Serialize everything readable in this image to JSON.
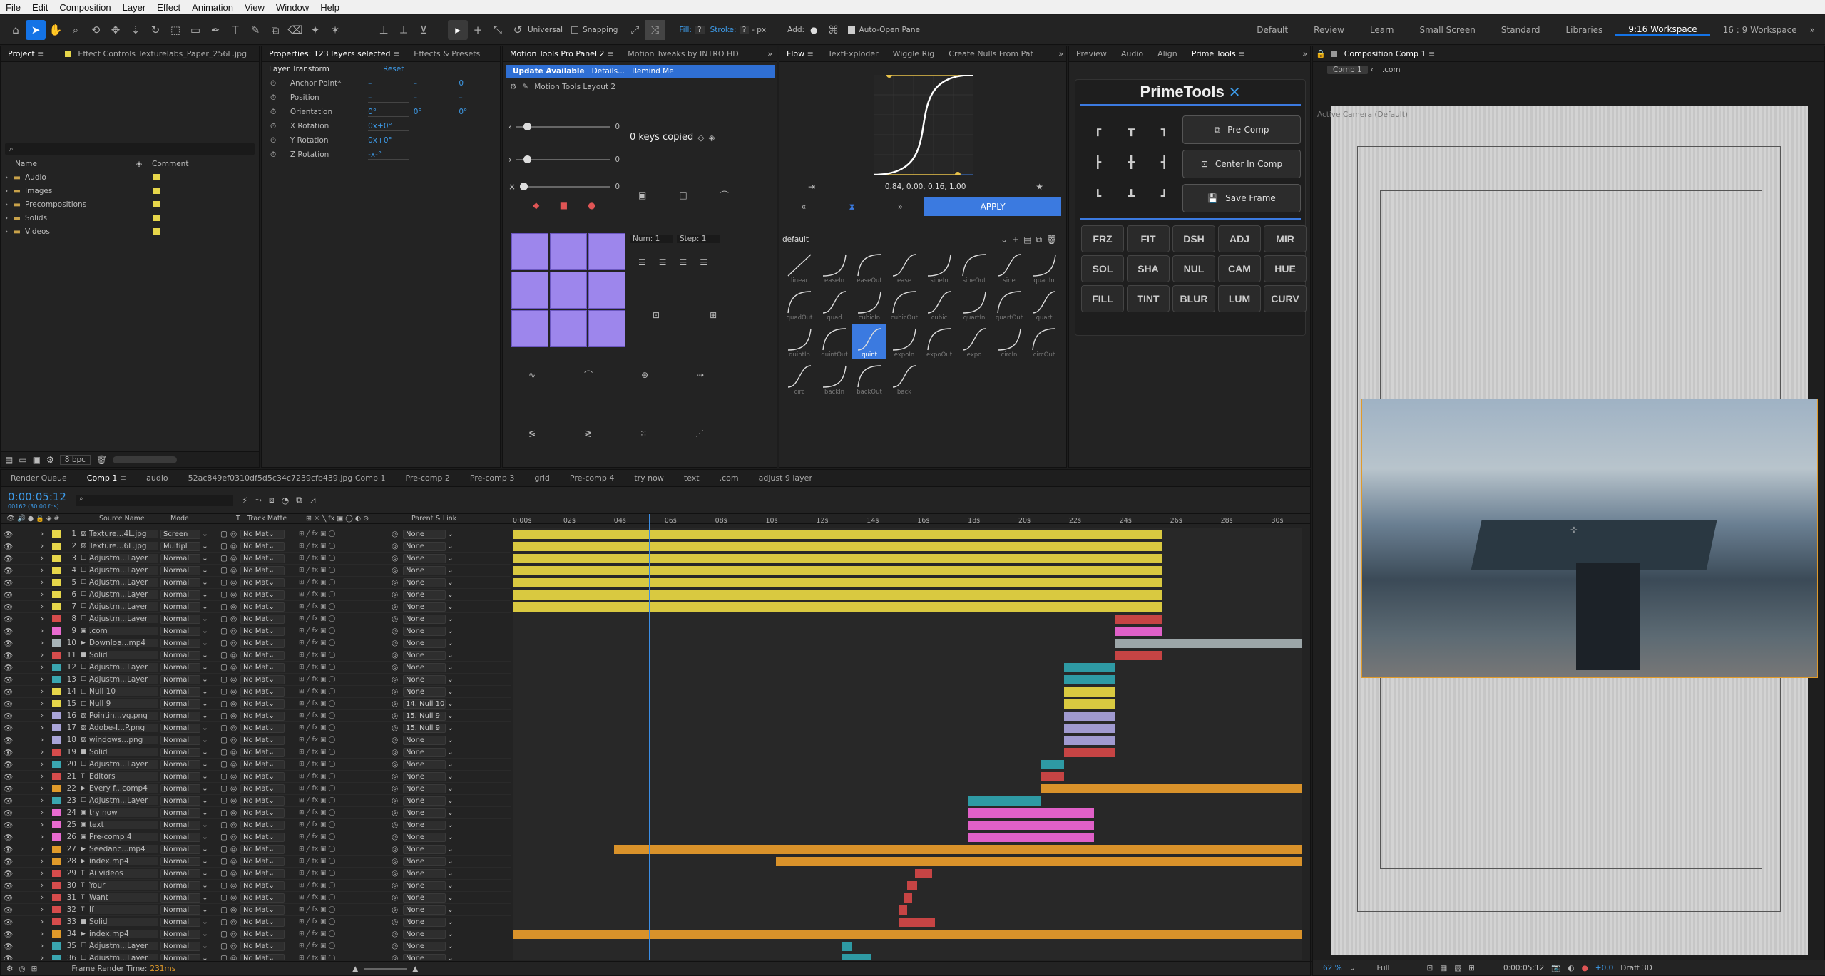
{
  "menu": [
    "File",
    "Edit",
    "Composition",
    "Layer",
    "Effect",
    "Animation",
    "View",
    "Window",
    "Help"
  ],
  "toolbar": {
    "axis_mode": "Universal",
    "snapping": "Snapping",
    "fill_label": "Fill:",
    "fill_value": "?",
    "stroke_label": "Stroke:",
    "stroke_value": "?",
    "stroke_px": "- px",
    "add_label": "Add:",
    "auto_open": "Auto-Open Panel",
    "workspaces": [
      "Default",
      "Review",
      "Learn",
      "Small Screen",
      "Standard",
      "Libraries",
      "9:16 Workspace",
      "16 : 9 Workspace"
    ],
    "active_workspace": "9:16 Workspace"
  },
  "project": {
    "tab": "Project",
    "effect_controls": "Effect Controls Texturelabs_Paper_256L.jpg",
    "search_placeholder": "",
    "col_name": "Name",
    "col_comment": "Comment",
    "folders": [
      "Audio",
      "Images",
      "Precompositions",
      "Solids",
      "Videos"
    ],
    "bpc": "8 bpc"
  },
  "properties": {
    "tab": "Properties: 123 layers selected",
    "tab2": "Effects & Presets",
    "section": "Layer Transform",
    "reset": "Reset",
    "rows": [
      {
        "label": "Anchor Point*",
        "v1": "–",
        "v2": "–",
        "v3": "0"
      },
      {
        "label": "Position",
        "v1": "–",
        "v2": "–",
        "v3": "–"
      },
      {
        "label": "Orientation",
        "v1": "0°",
        "v2": "0°",
        "v3": "0°"
      },
      {
        "label": "X Rotation",
        "v1": "0x+0°",
        "v2": "",
        "v3": ""
      },
      {
        "label": "Y Rotation",
        "v1": "0x+0°",
        "v2": "",
        "v3": ""
      },
      {
        "label": "Z Rotation",
        "v1": "-x-°",
        "v2": "",
        "v3": ""
      }
    ]
  },
  "motiontools": {
    "tab": "Motion Tools Pro Panel 2",
    "tab2": "Motion Tweaks by INTRO HD",
    "update": "Update Available",
    "details": "Details...",
    "remind": "Remind Me",
    "layout": "Motion Tools Layout 2",
    "keys_copied": "0 keys copied",
    "slider_values": [
      "0",
      "0",
      "0"
    ],
    "num": "Num: 1",
    "step": "Step: 1"
  },
  "flow": {
    "tabs": [
      "Flow",
      "TextExploder",
      "Wiggle Rig",
      "Create Nulls From Pat"
    ],
    "bezier": "0.84, 0.00, 0.16, 1.00",
    "apply": "APPLY",
    "preset": "default",
    "easings": [
      "linear",
      "easeIn",
      "easeOut",
      "ease",
      "sineIn",
      "sineOut",
      "sine",
      "quadIn",
      "quadOut",
      "quad",
      "cubicIn",
      "cubicOut",
      "cubic",
      "quartIn",
      "quartOut",
      "quart",
      "quintIn",
      "quintOut",
      "quint",
      "expoIn",
      "expoOut",
      "expo",
      "circIn",
      "circOut",
      "circ",
      "backIn",
      "backOut",
      "back"
    ],
    "selected_easing": "quint"
  },
  "primetools": {
    "tabs": [
      "Preview",
      "Audio",
      "Align",
      "Prime Tools"
    ],
    "title": "PrimeTools",
    "precomp": "Pre-Comp",
    "center": "Center In Comp",
    "save": "Save Frame",
    "buttons": [
      "FRZ",
      "FIT",
      "DSH",
      "ADJ",
      "MIR",
      "SOL",
      "SHA",
      "NUL",
      "CAM",
      "HUE",
      "FILL",
      "TINT",
      "BLUR",
      "LUM",
      "CURV"
    ]
  },
  "composition": {
    "tab": "Composition Comp 1",
    "crumb1": "Comp 1",
    "crumb2": ".com",
    "camera": "Active Camera (Default)",
    "zoom": "62 %",
    "quality": "Full",
    "time": "0:00:05:12",
    "exposure": "+0.0",
    "draft": "Draft 3D"
  },
  "timeline": {
    "tabs": [
      "Render Queue",
      "Comp 1",
      "audio",
      "52ac849ef0310df5d5c34c7239cfb439.jpg Comp 1",
      "Pre-comp 2",
      "Pre-comp 3",
      "grid",
      "Pre-comp 4",
      "try now",
      "text",
      ".com",
      "adjust 9 layer"
    ],
    "active_tab": "Comp 1",
    "timecode": "0:00:05:12",
    "frames": "00162 (30.00 fps)",
    "col_source": "Source Name",
    "col_mode": "Mode",
    "col_t": "T",
    "col_matte": "Track Matte",
    "col_parent": "Parent & Link",
    "ruler": [
      "0:00s",
      "02s",
      "04s",
      "06s",
      "08s",
      "10s",
      "12s",
      "14s",
      "16s",
      "18s",
      "20s",
      "22s",
      "24s",
      "26s",
      "28s",
      "30s"
    ],
    "render_time_label": "Frame Render Time:",
    "render_time": "231ms",
    "layers": [
      {
        "n": "1",
        "name": "Texture...4L.jpg",
        "mode": "Screen",
        "parent": "None",
        "color": "#e6d64a",
        "icon": "img"
      },
      {
        "n": "2",
        "name": "Texture...6L.jpg",
        "mode": "Multipl",
        "parent": "None",
        "color": "#e6d64a",
        "icon": "img"
      },
      {
        "n": "3",
        "name": "Adjustm...Layer",
        "mode": "Normal",
        "parent": "None",
        "color": "#e6d64a",
        "icon": "adj"
      },
      {
        "n": "4",
        "name": "Adjustm...Layer",
        "mode": "Normal",
        "parent": "None",
        "color": "#e6d64a",
        "icon": "adj"
      },
      {
        "n": "5",
        "name": "Adjustm...Layer",
        "mode": "Normal",
        "parent": "None",
        "color": "#e6d64a",
        "icon": "adj"
      },
      {
        "n": "6",
        "name": "Adjustm...Layer",
        "mode": "Normal",
        "parent": "None",
        "color": "#e6d64a",
        "icon": "adj"
      },
      {
        "n": "7",
        "name": "Adjustm...Layer",
        "mode": "Normal",
        "parent": "None",
        "color": "#e6d64a",
        "icon": "adj"
      },
      {
        "n": "8",
        "name": "Adjustm...Layer",
        "mode": "Normal",
        "parent": "None",
        "color": "#d64c4c",
        "icon": "adj"
      },
      {
        "n": "9",
        "name": ".com",
        "mode": "Normal",
        "parent": "None",
        "color": "#e86bd0",
        "icon": "comp"
      },
      {
        "n": "10",
        "name": "Downloa...mp4",
        "mode": "Normal",
        "parent": "None",
        "color": "#a8b4b8",
        "icon": "vid"
      },
      {
        "n": "11",
        "name": "Solid",
        "mode": "Normal",
        "parent": "None",
        "color": "#d64c4c",
        "icon": "sol"
      },
      {
        "n": "12",
        "name": "Adjustm...Layer",
        "mode": "Normal",
        "parent": "None",
        "color": "#3aa6b0",
        "icon": "adj"
      },
      {
        "n": "13",
        "name": "Adjustm...Layer",
        "mode": "Normal",
        "parent": "None",
        "color": "#3aa6b0",
        "icon": "adj"
      },
      {
        "n": "14",
        "name": "Null 10",
        "mode": "Normal",
        "parent": "None",
        "color": "#e6d64a",
        "icon": "null"
      },
      {
        "n": "15",
        "name": "Null 9",
        "mode": "Normal",
        "parent": "14. Null 10",
        "color": "#e6d64a",
        "icon": "null"
      },
      {
        "n": "16",
        "name": "Pointin...vg.png",
        "mode": "Normal",
        "parent": "15. Null 9",
        "color": "#a9a4d8",
        "icon": "img"
      },
      {
        "n": "17",
        "name": "Adobe-I...P.png",
        "mode": "Normal",
        "parent": "15. Null 9",
        "color": "#a9a4d8",
        "icon": "img"
      },
      {
        "n": "18",
        "name": "windows...png",
        "mode": "Normal",
        "parent": "None",
        "color": "#a9a4d8",
        "icon": "img"
      },
      {
        "n": "19",
        "name": "Solid",
        "mode": "Normal",
        "parent": "None",
        "color": "#d64c4c",
        "icon": "sol"
      },
      {
        "n": "20",
        "name": "Adjustm...Layer",
        "mode": "Normal",
        "parent": "None",
        "color": "#3aa6b0",
        "icon": "adj"
      },
      {
        "n": "21",
        "name": "Editors",
        "mode": "Normal",
        "parent": "None",
        "color": "#d64c4c",
        "icon": "txt"
      },
      {
        "n": "22",
        "name": "Every f...comp4",
        "mode": "Normal",
        "parent": "None",
        "color": "#e09a2a",
        "icon": "vid"
      },
      {
        "n": "23",
        "name": "Adjustm...Layer",
        "mode": "Normal",
        "parent": "None",
        "color": "#3aa6b0",
        "icon": "adj"
      },
      {
        "n": "24",
        "name": "try now",
        "mode": "Normal",
        "parent": "None",
        "color": "#e86bd0",
        "icon": "comp"
      },
      {
        "n": "25",
        "name": "text",
        "mode": "Normal",
        "parent": "None",
        "color": "#e86bd0",
        "icon": "comp"
      },
      {
        "n": "26",
        "name": "Pre-comp 4",
        "mode": "Normal",
        "parent": "None",
        "color": "#e86bd0",
        "icon": "comp"
      },
      {
        "n": "27",
        "name": "Seedanc...mp4",
        "mode": "Normal",
        "parent": "None",
        "color": "#e09a2a",
        "icon": "vid"
      },
      {
        "n": "28",
        "name": "index.mp4",
        "mode": "Normal",
        "parent": "None",
        "color": "#e09a2a",
        "icon": "vid"
      },
      {
        "n": "29",
        "name": "Ai videos",
        "mode": "Normal",
        "parent": "None",
        "color": "#d64c4c",
        "icon": "txt"
      },
      {
        "n": "30",
        "name": "Your",
        "mode": "Normal",
        "parent": "None",
        "color": "#d64c4c",
        "icon": "txt"
      },
      {
        "n": "31",
        "name": "Want",
        "mode": "Normal",
        "parent": "None",
        "color": "#d64c4c",
        "icon": "txt"
      },
      {
        "n": "32",
        "name": "If",
        "mode": "Normal",
        "parent": "None",
        "color": "#d64c4c",
        "icon": "txt"
      },
      {
        "n": "33",
        "name": "Solid",
        "mode": "Normal",
        "parent": "None",
        "color": "#d64c4c",
        "icon": "sol"
      },
      {
        "n": "34",
        "name": "index.mp4",
        "mode": "Normal",
        "parent": "None",
        "color": "#e09a2a",
        "icon": "vid"
      },
      {
        "n": "35",
        "name": "Adjustm...Layer",
        "mode": "Normal",
        "parent": "None",
        "color": "#3aa6b0",
        "icon": "adj"
      },
      {
        "n": "36",
        "name": "Adjustm...Layer",
        "mode": "Normal",
        "parent": "None",
        "color": "#3aa6b0",
        "icon": "adj"
      }
    ],
    "bars": [
      {
        "s": 0,
        "e": 25.7,
        "c": "#d9c940"
      },
      {
        "s": 0,
        "e": 25.7,
        "c": "#d9c940"
      },
      {
        "s": 0,
        "e": 25.7,
        "c": "#d9c940"
      },
      {
        "s": 0,
        "e": 25.7,
        "c": "#d9c940"
      },
      {
        "s": 0,
        "e": 25.7,
        "c": "#d9c940"
      },
      {
        "s": 0,
        "e": 25.7,
        "c": "#d9c940"
      },
      {
        "s": 0,
        "e": 25.7,
        "c": "#d9c940"
      },
      {
        "s": 23.8,
        "e": 25.7,
        "c": "#c64444"
      },
      {
        "s": 23.8,
        "e": 25.7,
        "c": "#e060c8"
      },
      {
        "s": 23.8,
        "e": 31.2,
        "c": "#9ca6a8"
      },
      {
        "s": 23.8,
        "e": 25.7,
        "c": "#c64444"
      },
      {
        "s": 21.8,
        "e": 23.8,
        "c": "#2e9aa4"
      },
      {
        "s": 21.8,
        "e": 23.8,
        "c": "#2e9aa4"
      },
      {
        "s": 21.8,
        "e": 23.8,
        "c": "#d9c940"
      },
      {
        "s": 21.8,
        "e": 23.8,
        "c": "#d9c940"
      },
      {
        "s": 21.8,
        "e": 23.8,
        "c": "#a09ad0"
      },
      {
        "s": 21.8,
        "e": 23.8,
        "c": "#a09ad0"
      },
      {
        "s": 21.8,
        "e": 23.8,
        "c": "#a09ad0"
      },
      {
        "s": 21.8,
        "e": 23.8,
        "c": "#c64444"
      },
      {
        "s": 20.9,
        "e": 21.8,
        "c": "#2e9aa4"
      },
      {
        "s": 20.9,
        "e": 21.8,
        "c": "#c64444"
      },
      {
        "s": 20.9,
        "e": 31.2,
        "c": "#d9922a"
      },
      {
        "s": 18.0,
        "e": 20.9,
        "c": "#2e9aa4"
      },
      {
        "s": 18.0,
        "e": 23.0,
        "c": "#e060c8"
      },
      {
        "s": 18.0,
        "e": 23.0,
        "c": "#e060c8"
      },
      {
        "s": 18.0,
        "e": 23.0,
        "c": "#e060c8"
      },
      {
        "s": 4.0,
        "e": 31.2,
        "c": "#d9922a"
      },
      {
        "s": 10.4,
        "e": 31.2,
        "c": "#d9922a"
      },
      {
        "s": 15.9,
        "e": 16.6,
        "c": "#c64444"
      },
      {
        "s": 15.6,
        "e": 16.0,
        "c": "#c64444"
      },
      {
        "s": 15.5,
        "e": 15.8,
        "c": "#c64444"
      },
      {
        "s": 15.3,
        "e": 15.6,
        "c": "#c64444"
      },
      {
        "s": 15.3,
        "e": 16.7,
        "c": "#c64444"
      },
      {
        "s": 0,
        "e": 31.2,
        "c": "#d9922a"
      },
      {
        "s": 13.0,
        "e": 13.4,
        "c": "#2e9aa4"
      },
      {
        "s": 13.0,
        "e": 14.2,
        "c": "#2e9aa4"
      }
    ],
    "playhead_sec": 5.4,
    "duration_sec": 31.2
  },
  "colors": {
    "accent": "#1473e6",
    "purple": "#9d86ec",
    "flow_apply": "#3b7ae0",
    "update_bar": "#2f6fd4",
    "label_yellow": "#e6d64a"
  }
}
